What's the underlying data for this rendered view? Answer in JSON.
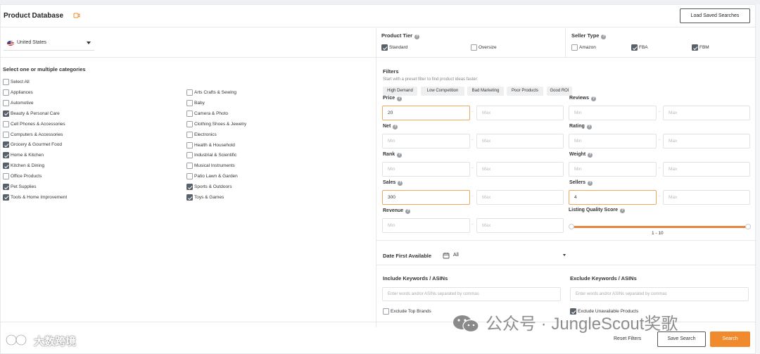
{
  "header": {
    "title": "Product Database",
    "load_saved_label": "Load Saved Searches"
  },
  "country": {
    "selected": "United States"
  },
  "categories": {
    "heading": "Select one or multiple categories",
    "left": [
      {
        "label": "Select All",
        "checked": false
      },
      {
        "label": "Appliances",
        "checked": false
      },
      {
        "label": "Automotive",
        "checked": false
      },
      {
        "label": "Beauty & Personal Care",
        "checked": true
      },
      {
        "label": "Cell Phones & Accessories",
        "checked": false
      },
      {
        "label": "Computers & Accessories",
        "checked": false
      },
      {
        "label": "Grocery & Gourmet Food",
        "checked": true
      },
      {
        "label": "Home & Kitchen",
        "checked": true
      },
      {
        "label": "Kitchen & Dining",
        "checked": true
      },
      {
        "label": "Office Products",
        "checked": false
      },
      {
        "label": "Pet Supplies",
        "checked": true
      },
      {
        "label": "Tools & Home Improvement",
        "checked": true
      }
    ],
    "right": [
      {
        "label": "Arts Crafts & Sewing",
        "checked": false
      },
      {
        "label": "Baby",
        "checked": false
      },
      {
        "label": "Camera & Photo",
        "checked": false
      },
      {
        "label": "Clothing Shoes & Jewelry",
        "checked": false
      },
      {
        "label": "Electronics",
        "checked": false
      },
      {
        "label": "Health & Household",
        "checked": false
      },
      {
        "label": "Industrial & Scientific",
        "checked": false
      },
      {
        "label": "Musical Instruments",
        "checked": false
      },
      {
        "label": "Patio Lawn & Garden",
        "checked": false
      },
      {
        "label": "Sports & Outdoors",
        "checked": true
      },
      {
        "label": "Toys & Games",
        "checked": true
      }
    ]
  },
  "product_tier": {
    "label": "Product Tier",
    "options": [
      {
        "label": "Standard",
        "checked": true
      },
      {
        "label": "Oversize",
        "checked": false
      }
    ]
  },
  "seller_type": {
    "label": "Seller Type",
    "options": [
      {
        "label": "Amazon",
        "checked": false
      },
      {
        "label": "FBA",
        "checked": true
      },
      {
        "label": "FBM",
        "checked": true
      }
    ]
  },
  "filters": {
    "title": "Filters",
    "subtitle": "Start with a preset filter to find product ideas faster:",
    "presets": [
      "High Demand",
      "Low Competition",
      "Bad Marketing",
      "Poor Products",
      "Good ROI"
    ],
    "min_placeholder": "Min",
    "max_placeholder": "Max",
    "fields": {
      "price": {
        "label": "Price",
        "min": "20",
        "max": ""
      },
      "reviews": {
        "label": "Reviews",
        "min": "",
        "max": ""
      },
      "net": {
        "label": "Net",
        "min": "",
        "max": ""
      },
      "rating": {
        "label": "Rating",
        "min": "",
        "max": ""
      },
      "rank": {
        "label": "Rank",
        "min": "",
        "max": ""
      },
      "weight": {
        "label": "Weight",
        "min": "",
        "max": ""
      },
      "sales": {
        "label": "Sales",
        "min": "300",
        "max": ""
      },
      "sellers": {
        "label": "Sellers",
        "min": "4",
        "max": ""
      },
      "revenue": {
        "label": "Revenue",
        "min": "",
        "max": ""
      },
      "lqs": {
        "label": "Listing Quality Score",
        "range_text": "1 - 10",
        "min_value": 1,
        "max_value": 10
      }
    }
  },
  "date_first_available": {
    "label": "Date First Available",
    "value": "All"
  },
  "keywords": {
    "include_label": "Include Keywords / ASINs",
    "exclude_label": "Exclude Keywords / ASINs",
    "placeholder": "Enter words and/or ASINs separated by commas"
  },
  "options": {
    "exclude_top_brands": {
      "label": "Exclude Top Brands",
      "checked": false
    },
    "exclude_unavailable": {
      "label": "Exclude Unavailable Products",
      "checked": true
    }
  },
  "actions": {
    "reset": "Reset Filters",
    "save": "Save Search",
    "search": "Search"
  },
  "watermark": {
    "left": "大数跨境",
    "right": "公众号 · JungleScout奖歌"
  },
  "colors": {
    "accent": "#f08a2c",
    "checkbox_checked": "#58606a"
  }
}
